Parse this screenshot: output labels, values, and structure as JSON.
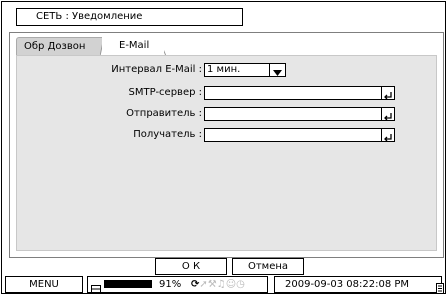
{
  "window": {
    "title": "СЕТЬ : Уведомление"
  },
  "tabs": [
    {
      "label": "Обр Дозвон",
      "active": false
    },
    {
      "label": "E-Mail",
      "active": true
    }
  ],
  "form": {
    "interval": {
      "label": "Интервал E-Mail :",
      "value": "1 мин."
    },
    "smtp": {
      "label": "SMTP-сервер :",
      "value": ""
    },
    "sender": {
      "label": "Отправитель :",
      "value": ""
    },
    "recipient": {
      "label": "Получатель :",
      "value": ""
    }
  },
  "buttons": {
    "ok": "О К",
    "cancel": "Отмена"
  },
  "statusbar": {
    "menu": "MENU",
    "battery_percent": "91%",
    "battery_level": 0.91,
    "datetime": "2009-09-03 08:22:08 PM"
  },
  "icons": [
    "hdd-icon",
    "sync-icon",
    "arrow-icon",
    "wrench-icon",
    "alarm-icon",
    "person-icon",
    "clock-icon",
    "enter-icon",
    "dropdown-arrow-icon",
    "document-icon"
  ]
}
